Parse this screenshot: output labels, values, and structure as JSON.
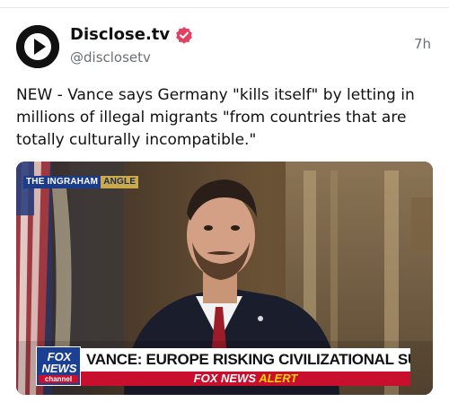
{
  "post": {
    "author": {
      "display_name": "Disclose.tv",
      "handle": "@disclosetv",
      "verified_badge_color": "#e4405f"
    },
    "time": "7h",
    "text": "NEW - Vance says Germany \"kills itself\" by letting in millions of illegal migrants \"from countries that are totally culturally incompatible.\""
  },
  "media": {
    "show_label_part1": "THE INGRAHAM",
    "show_label_part2": "ANGLE",
    "logo_line1": "FOX",
    "logo_line2": "NEWS",
    "logo_channel": "channel",
    "chyron": "VANCE: EUROPE RISKING CIVILIZATIONAL SUICIDE",
    "alert_network": "FOX NEWS",
    "alert_word": "ALERT"
  },
  "colors": {
    "fox_blue": "#1b3f93",
    "fox_red": "#c8102e",
    "alert_yellow": "#ffd200"
  }
}
